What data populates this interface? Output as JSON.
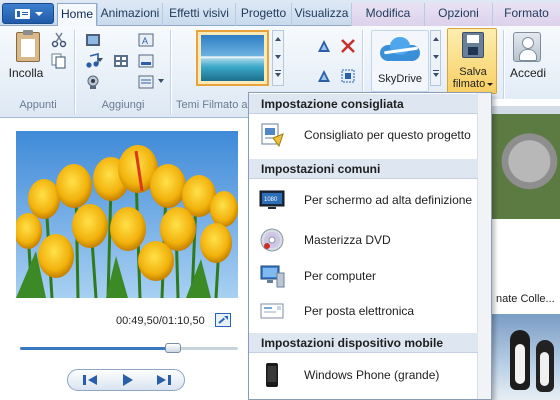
{
  "tabs": [
    {
      "label": "Home",
      "active": true
    },
    {
      "label": "Animazioni"
    },
    {
      "label": "Effetti visivi"
    },
    {
      "label": "Progetto"
    },
    {
      "label": "Visualizza"
    },
    {
      "label": "Modifica",
      "contextual": true
    },
    {
      "label": "Opzioni",
      "contextual": true
    },
    {
      "label": "Formato",
      "contextual": true
    }
  ],
  "ribbon": {
    "paste_label": "Incolla",
    "groups": {
      "clipboard": "Appunti",
      "add": "Aggiungi",
      "themes": "Temi Filmato a"
    },
    "skydrive_label": "SkyDrive",
    "save_label_line1": "Salva",
    "save_label_line2": "filmato",
    "signin_label": "Accedi"
  },
  "player": {
    "time": "00:49,50/01:10,50",
    "progress_fraction": 0.7
  },
  "storyboard": {
    "caption": "nate Colle..."
  },
  "menu": {
    "sections": [
      {
        "header": "Impostazione consigliata",
        "items": [
          {
            "label": "Consigliato per questo progetto",
            "icon": "recommended-settings-icon"
          }
        ]
      },
      {
        "header": "Impostazioni comuni",
        "items": [
          {
            "label": "Per schermo ad alta definizione",
            "icon": "hd-display-icon"
          },
          {
            "label": "Masterizza DVD",
            "icon": "dvd-icon"
          },
          {
            "label": "Per computer",
            "icon": "computer-icon"
          },
          {
            "label": "Per posta elettronica",
            "icon": "email-icon"
          }
        ]
      },
      {
        "header": "Impostazioni dispositivo mobile",
        "items": [
          {
            "label": "Windows Phone (grande)",
            "icon": "windows-phone-icon"
          }
        ]
      }
    ]
  },
  "colors": {
    "ribbon_bg": "#dde8f4",
    "save_button_highlight": "#f8cf62",
    "app_button": "#2a63b0",
    "seek_fill": "#3a78c6"
  }
}
